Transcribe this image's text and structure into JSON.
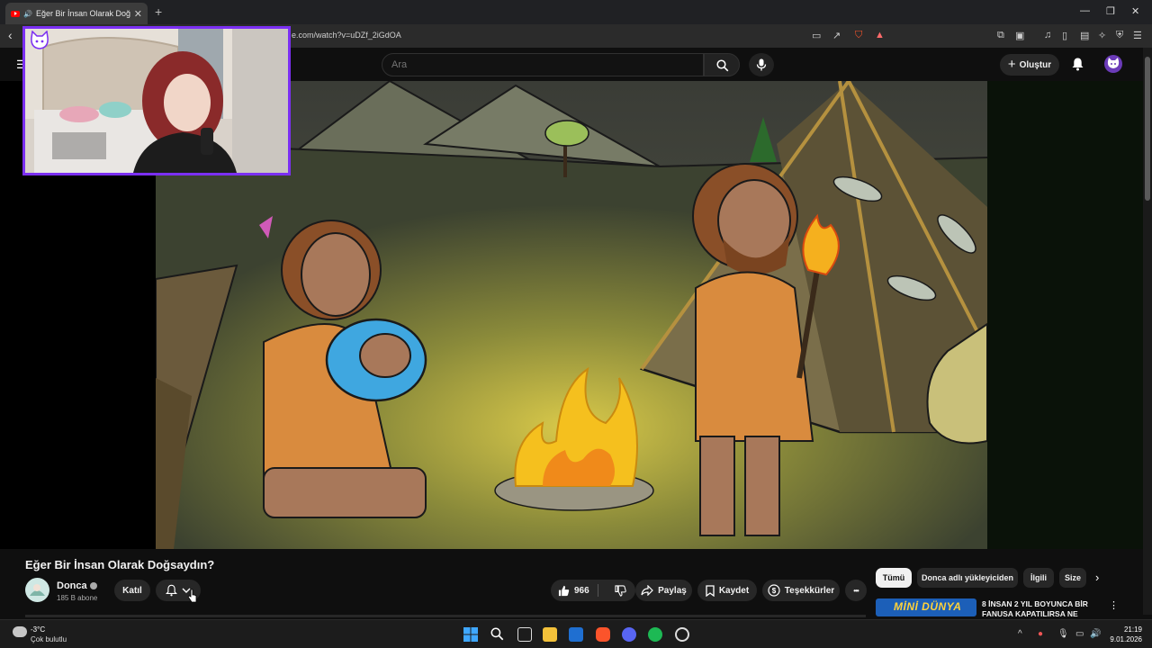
{
  "browser": {
    "tab_title": "Eğer Bir İnsan Olarak Doğsay",
    "tab_close": "✕",
    "new_tab": "+",
    "url": "e.com/watch?v=uDZf_2iGdOA"
  },
  "youtube": {
    "search_placeholder": "Ara",
    "create_label": "Oluştur"
  },
  "video": {
    "title": "Eğer Bir İnsan Olarak Doğsaydın?"
  },
  "channel": {
    "name": "Donca",
    "subscribers": "185 B abone",
    "join_label": "Katıl"
  },
  "actions": {
    "likes": "966",
    "share_label": "Paylaş",
    "save_label": "Kaydet",
    "thanks_label": "Teşekkürler",
    "more_label": "•••"
  },
  "chips": {
    "all": "Tümü",
    "from_channel": "Donca adlı yükleyiciden",
    "related": "İlgili",
    "for_you": "Size"
  },
  "recommendation": {
    "thumb_text": "MİNİ DÜNYA",
    "title": "8 İNSAN 2 YIL BOYUNCA BİR FANUSA KAPATILIRSA NE"
  },
  "taskbar": {
    "temperature": "-3°C",
    "condition": "Çok bulutlu",
    "time": "21:19",
    "date": "9.01.2026"
  },
  "colors": {
    "accent": "#7b2ff2",
    "youtube_red": "#ff0000",
    "background": "#0f0f0f"
  }
}
